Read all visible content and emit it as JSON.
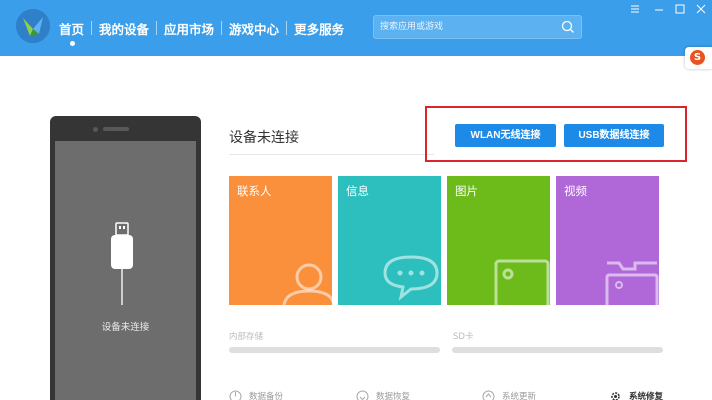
{
  "nav": {
    "items": [
      {
        "label": "首页",
        "active": true
      },
      {
        "label": "我的设备"
      },
      {
        "label": "应用市场"
      },
      {
        "label": "游戏中心"
      },
      {
        "label": "更多服务"
      }
    ]
  },
  "search": {
    "placeholder": "搜索应用或游戏",
    "icon": "search-icon"
  },
  "window_controls": [
    "menu-icon",
    "minimize-icon",
    "maximize-icon",
    "close-icon"
  ],
  "sogou": {
    "letter": "S"
  },
  "phone": {
    "status": "设备未连接",
    "icon": "usb-cable-icon"
  },
  "main": {
    "title": "设备未连接",
    "wlan_button": "WLAN无线连接",
    "usb_button": "USB数据线连接"
  },
  "tiles": [
    {
      "label": "联系人",
      "color": "#fa8f3c",
      "icon": "contacts-icon"
    },
    {
      "label": "信息",
      "color": "#2cbfbe",
      "icon": "message-icon"
    },
    {
      "label": "图片",
      "color": "#6cbb1b",
      "icon": "image-icon"
    },
    {
      "label": "视频",
      "color": "#b067d8",
      "icon": "video-icon"
    }
  ],
  "storage": {
    "internal_label": "内部存储",
    "sd_label": "SD卡"
  },
  "bottom": [
    {
      "label": "数据备份",
      "icon": "backup-icon"
    },
    {
      "label": "数据恢复",
      "icon": "restore-icon"
    },
    {
      "label": "系统更新",
      "icon": "update-icon"
    },
    {
      "label": "系统修复",
      "icon": "gear-icon"
    }
  ],
  "colors": {
    "topbar": "#3a9eea",
    "button": "#1c8ae6",
    "highlight": "#d9262c"
  }
}
